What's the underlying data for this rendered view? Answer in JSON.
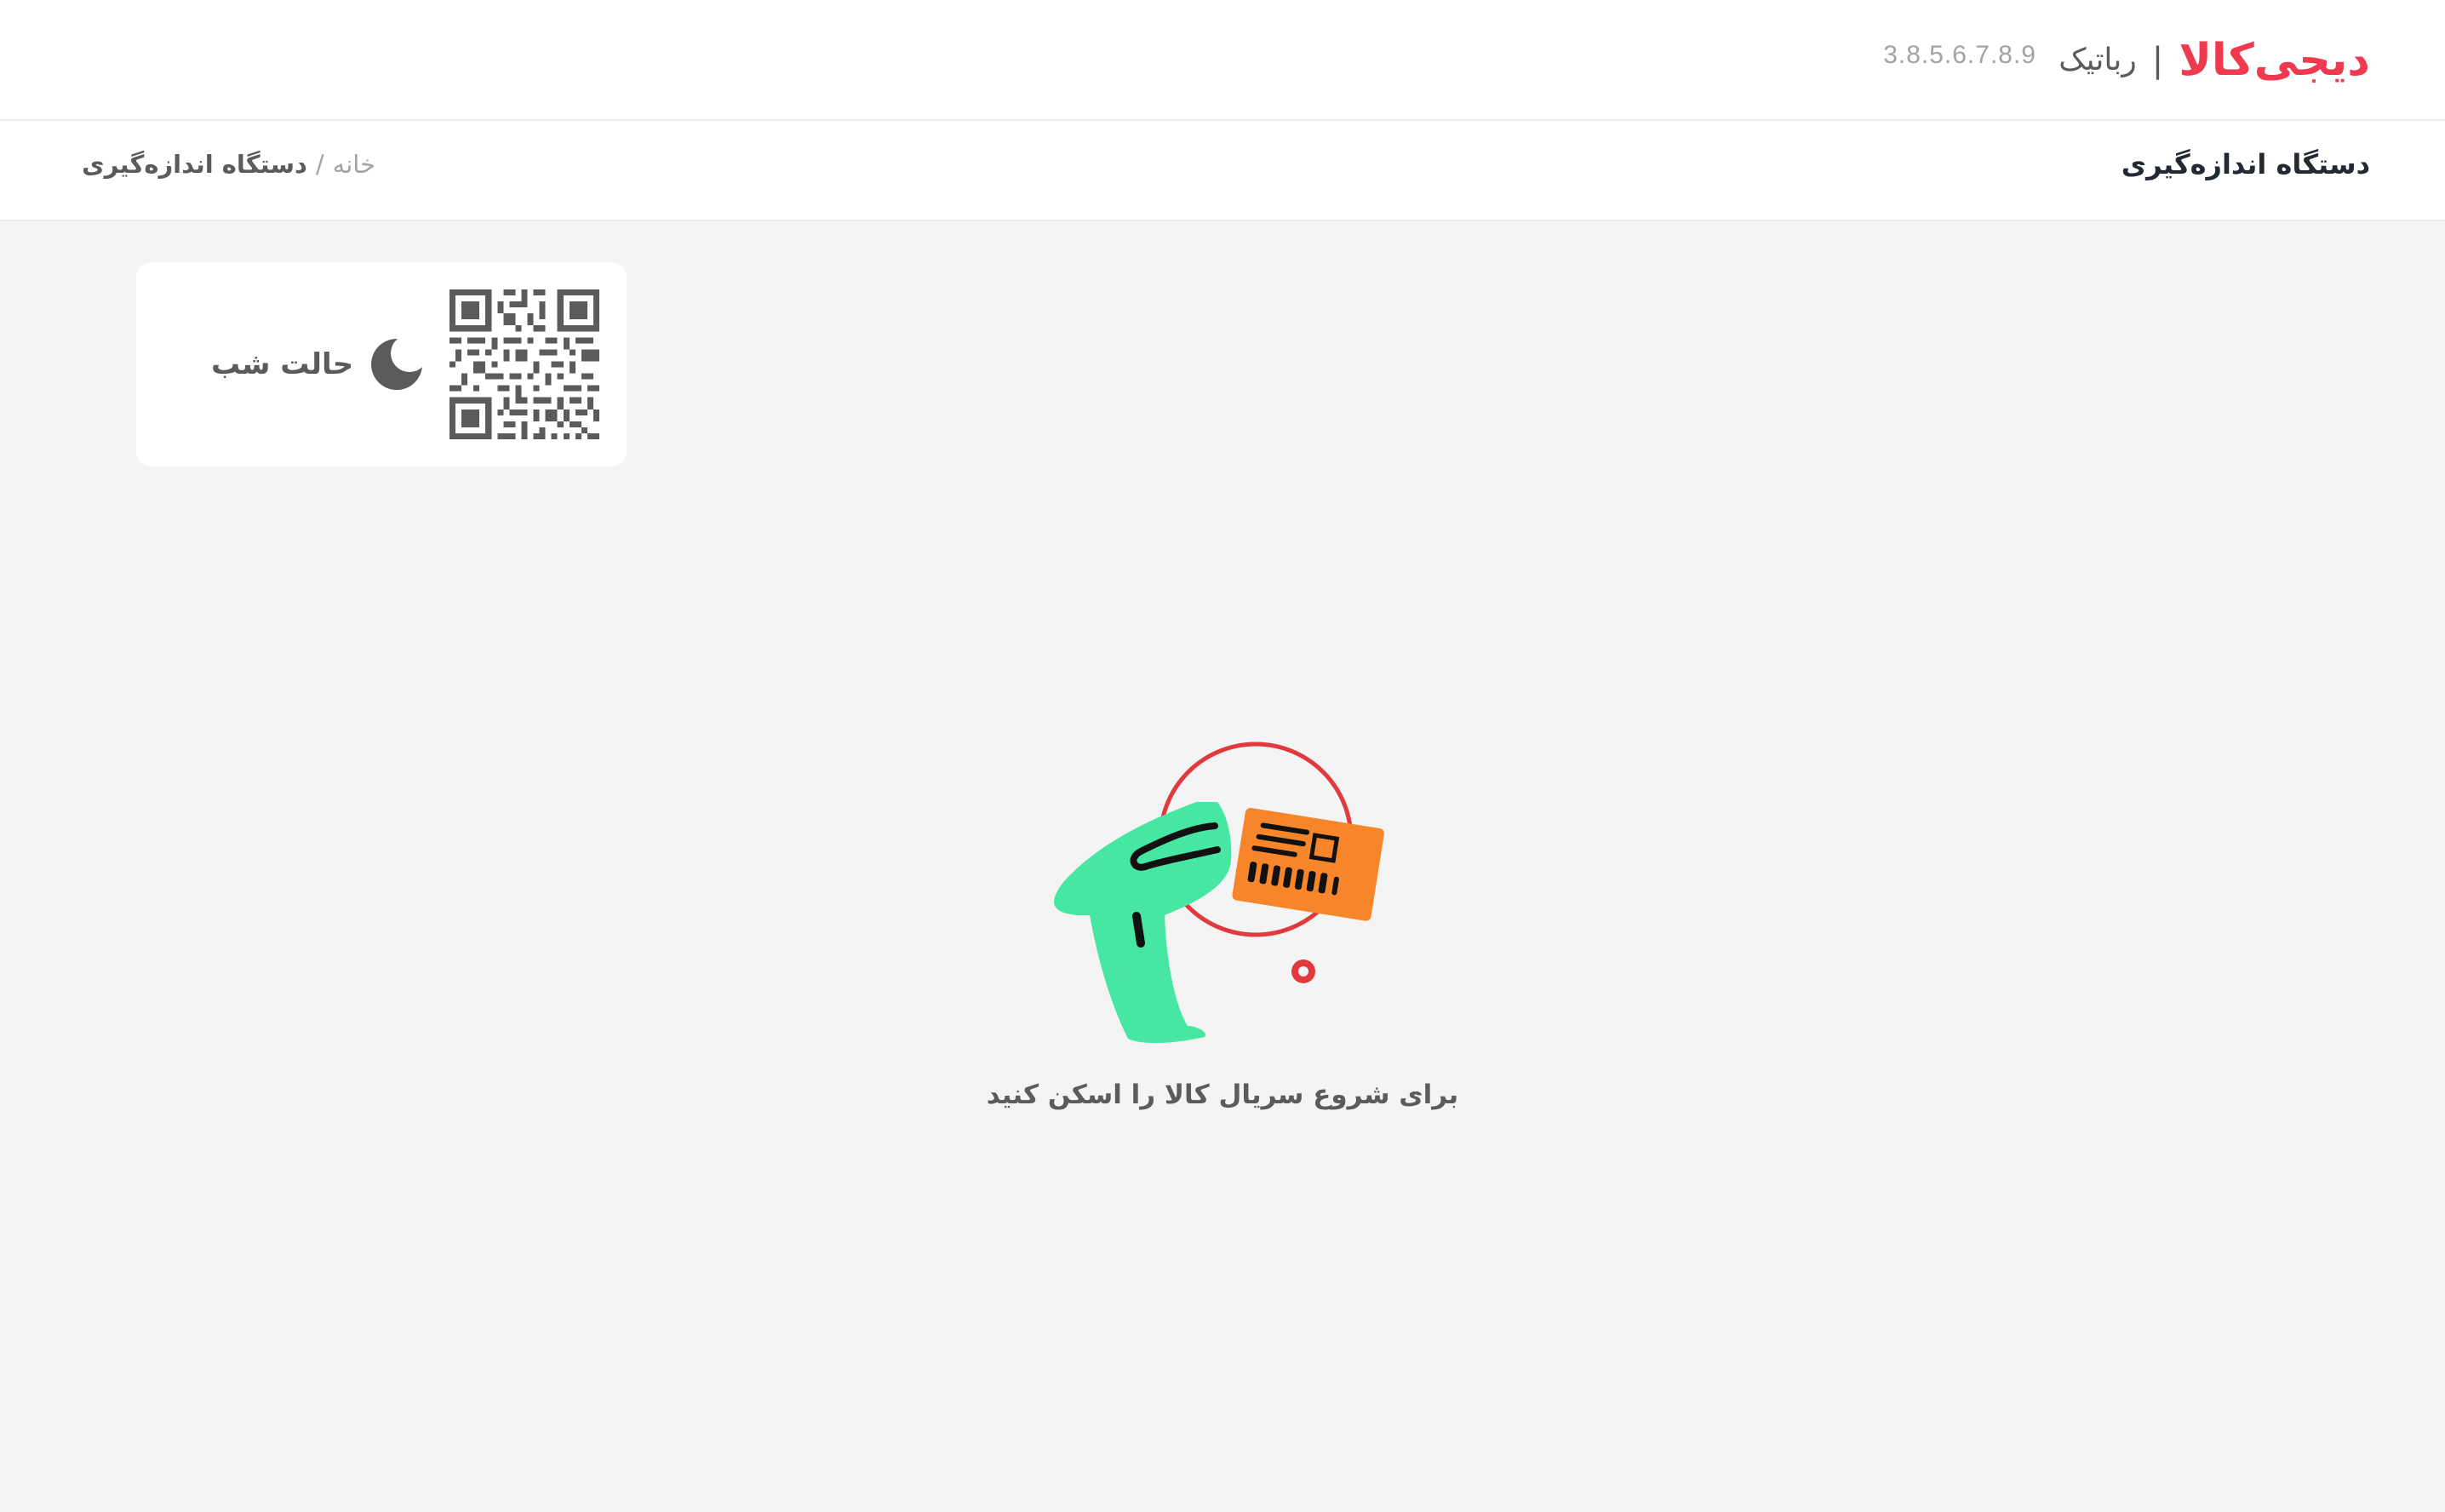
{
  "header": {
    "logo_text": "دیجی‌کالا",
    "separator": "|",
    "sub_brand": "رباتیک",
    "version": "3.8.5.6.7.8.9"
  },
  "subbar": {
    "page_title": "دستگاه اندازه‌گیری",
    "breadcrumb": {
      "home": "خانه",
      "separator": "/",
      "current": "دستگاه اندازه‌گیری"
    }
  },
  "card": {
    "night_mode_label": "حالت شب",
    "icons": [
      "qr-code-icon",
      "moon-icon"
    ]
  },
  "main": {
    "hint": "برای شروع سریال کالا را اسکن کنید",
    "illustration": "barcode-scanner-illustration"
  },
  "colors": {
    "brand": "#ef394e",
    "background": "#f4f4f4",
    "scanner": "#46e6a3",
    "label": "#f7862a",
    "ring": "#e0393e",
    "icon_gray": "#5b5b5b"
  }
}
